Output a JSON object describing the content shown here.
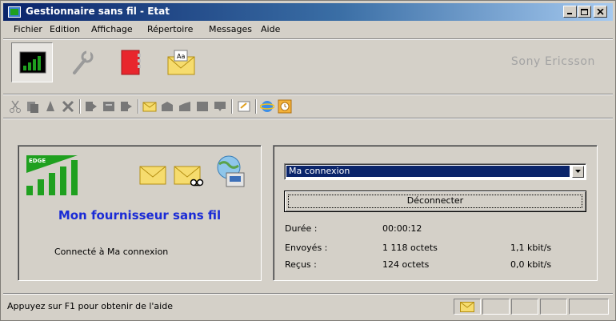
{
  "window": {
    "title": "Gestionnaire sans fil - Etat"
  },
  "menubar": {
    "items": [
      "Fichier",
      "Edition",
      "Affichage",
      "Répertoire",
      "Messages",
      "Aide"
    ]
  },
  "toolbar": {
    "brand": "Sony Ericsson",
    "big_buttons": [
      "status-icon",
      "wrench-icon",
      "phonebook-icon",
      "messages-icon"
    ],
    "small_buttons": [
      "cut-icon",
      "copy-icon",
      "paste-icon",
      "delete-icon",
      "import-icon",
      "export-icon",
      "sync-icon",
      "new-message-icon",
      "inbox-icon",
      "outbox-icon",
      "sent-icon",
      "draft-icon",
      "contact-card-icon",
      "browser-icon",
      "timer-icon"
    ]
  },
  "status_panel": {
    "network_label": "EDGE",
    "provider": "Mon fournisseur sans fil",
    "connection_status": "Connecté à Ma connexion"
  },
  "connection_panel": {
    "selected_connection": "Ma connexion",
    "disconnect_label": "Déconnecter",
    "stats": {
      "duration": {
        "label": "Durée :",
        "value": "00:00:12"
      },
      "sent": {
        "label": "Envoyés :",
        "value": "1 118 octets",
        "rate": "1,1 kbit/s"
      },
      "received": {
        "label": "Reçus :",
        "value": "124 octets",
        "rate": "0,0 kbit/s"
      }
    }
  },
  "statusbar": {
    "help_text": "Appuyez sur F1 pour obtenir de l'aide"
  },
  "colors": {
    "title_bar": "#0a246a",
    "provider_text": "#1a2bd6",
    "signal_green": "#1fa01f"
  }
}
